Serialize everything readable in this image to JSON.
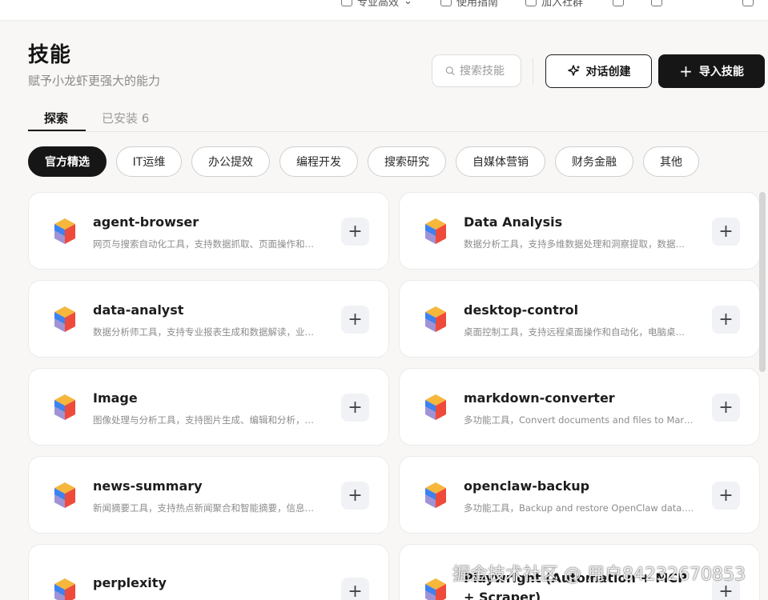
{
  "topbar": {
    "items": [
      {
        "label": "专业高效",
        "icon": "user-icon"
      },
      {
        "label": "使用指南",
        "icon": "book-icon"
      },
      {
        "label": "加入社群",
        "icon": "group-icon"
      },
      {
        "label": "",
        "icon": "chat-icon"
      },
      {
        "label": "",
        "icon": "window-icon"
      },
      {
        "label": "",
        "icon": "square-icon"
      }
    ]
  },
  "header": {
    "title": "技能",
    "subtitle": "赋予小龙虾更强大的能力",
    "search_placeholder": "搜索技能",
    "chat_create_label": "对话创建",
    "import_label": "导入技能"
  },
  "tabs": [
    {
      "label": "探索",
      "active": true
    },
    {
      "label": "已安装 6",
      "active": false
    }
  ],
  "chips": [
    {
      "label": "官方精选",
      "active": true
    },
    {
      "label": "IT运维",
      "active": false
    },
    {
      "label": "办公提效",
      "active": false
    },
    {
      "label": "编程开发",
      "active": false
    },
    {
      "label": "搜索研究",
      "active": false
    },
    {
      "label": "自媒体营销",
      "active": false
    },
    {
      "label": "财务金融",
      "active": false
    },
    {
      "label": "其他",
      "active": false
    }
  ],
  "skills": [
    {
      "name": "agent-browser",
      "desc": "网页与搜索自动化工具，支持数据抓取、页面操作和…"
    },
    {
      "name": "Data Analysis",
      "desc": "数据分析工具，支持多维数据处理和洞察提取，数据…"
    },
    {
      "name": "data-analyst",
      "desc": "数据分析师工具，支持专业报表生成和数据解读，业…"
    },
    {
      "name": "desktop-control",
      "desc": "桌面控制工具，支持远程桌面操作和自动化，电脑桌…"
    },
    {
      "name": "Image",
      "desc": "图像处理与分析工具，支持图片生成、编辑和分析，…"
    },
    {
      "name": "markdown-converter",
      "desc": "多功能工具，Convert documents and files to Mark…"
    },
    {
      "name": "news-summary",
      "desc": "新闻摘要工具，支持热点新闻聚合和智能摘要，信息…"
    },
    {
      "name": "openclaw-backup",
      "desc": "多功能工具，Backup and restore OpenClaw data. …"
    },
    {
      "name": "perplexity",
      "desc": ""
    },
    {
      "name": "Playwright (Automation + MCP + Scraper)",
      "desc": ""
    }
  ],
  "watermark": "掘金技术社区 @ 用户842326708​53",
  "colors": {
    "accent": "#161616",
    "background": "#f8f7f5",
    "card": "#ffffff"
  }
}
